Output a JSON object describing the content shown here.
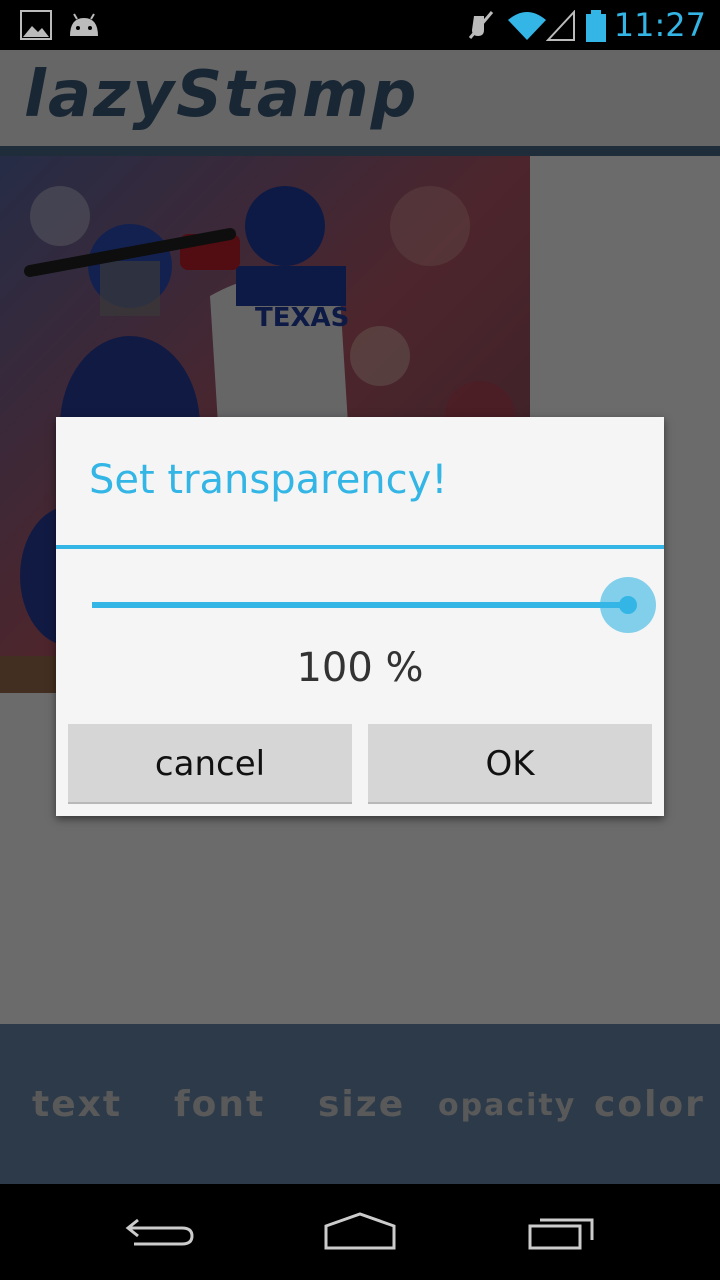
{
  "status_bar": {
    "time": "11:27",
    "icons": [
      "gallery-icon",
      "android-icon",
      "mute-icon",
      "wifi-icon",
      "signal-icon",
      "battery-icon"
    ]
  },
  "app": {
    "logo": "lazyStamp",
    "tools": [
      "text",
      "font",
      "size",
      "opacity",
      "color"
    ]
  },
  "dialog": {
    "title": "Set transparency!",
    "slider_value": 100,
    "value_label": "100 %",
    "cancel_label": "cancel",
    "ok_label": "OK"
  },
  "colors": {
    "accent": "#33b5e5",
    "logo": "#3d5e7e",
    "bottom_bar": "#6a8bb0"
  },
  "nav": {
    "icons": [
      "back-icon",
      "home-icon",
      "recents-icon"
    ]
  }
}
